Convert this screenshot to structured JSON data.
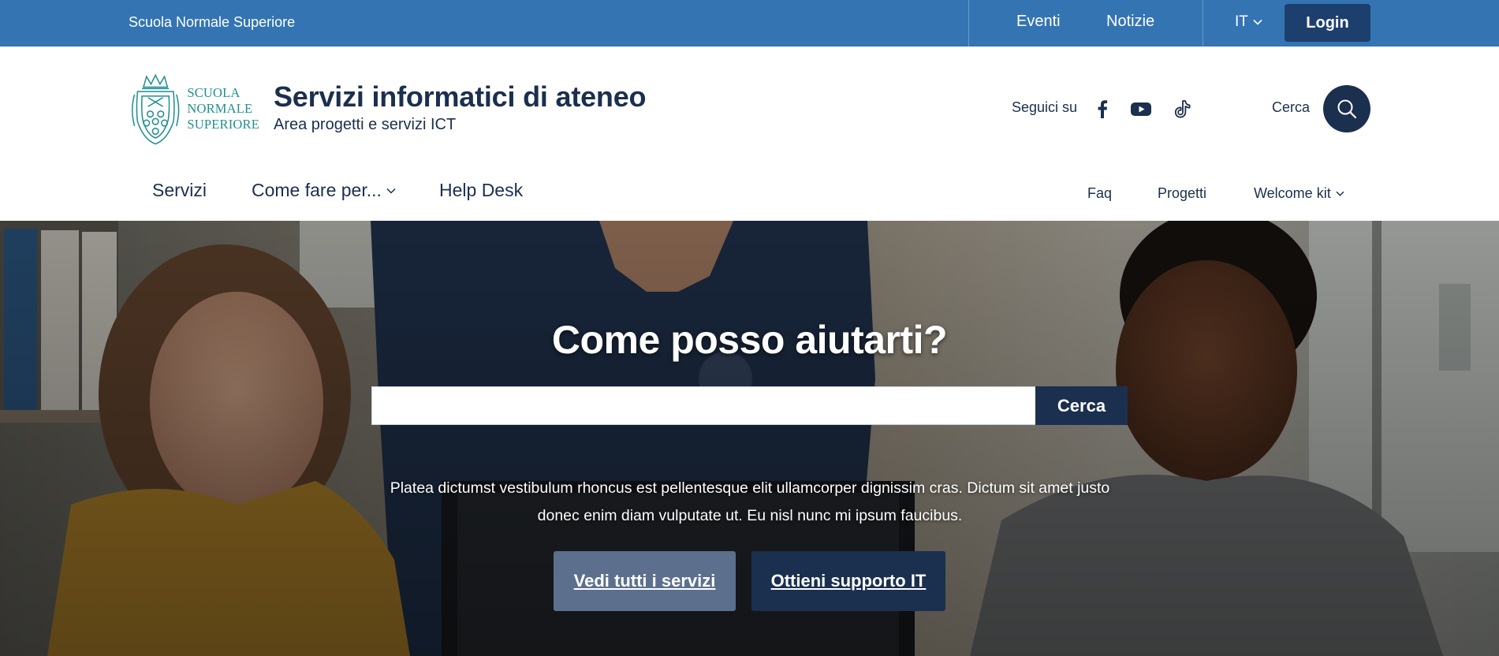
{
  "topbar": {
    "org_name": "Scuola Normale Superiore",
    "links": [
      "Eventi",
      "Notizie"
    ],
    "language": "IT",
    "login_label": "Login"
  },
  "header": {
    "logo_text": [
      "SCUOLA",
      "NORMALE",
      "SUPERIORE"
    ],
    "title": "Servizi informatici di ateneo",
    "subtitle": "Area progetti e servizi ICT",
    "follow_label": "Seguici su",
    "social_icons": [
      "facebook-icon",
      "youtube-icon",
      "tiktok-icon"
    ],
    "search_label": "Cerca"
  },
  "nav": {
    "main": [
      "Servizi",
      "Come fare per...",
      "Help Desk"
    ],
    "secondary": [
      "Faq",
      "Progetti",
      "Welcome kit"
    ]
  },
  "hero": {
    "title": "Come posso aiutarti?",
    "search_placeholder": "",
    "search_button": "Cerca",
    "description": "Platea dictumst vestibulum rhoncus est pellentesque elit ullamcorper dignissim cras. Dictum sit amet justo donec enim diam vulputate ut. Eu nisl nunc mi ipsum faucibus.",
    "button_services": "Vedi tutti i servizi",
    "button_support": "Ottieni supporto IT"
  },
  "colors": {
    "topbar": "#3474b3",
    "login_bg": "#1d3f6e",
    "primary_dark": "#1b2f4e",
    "secondary_button": "#5c6f8d",
    "logo_teal": "#1f8f8f"
  }
}
